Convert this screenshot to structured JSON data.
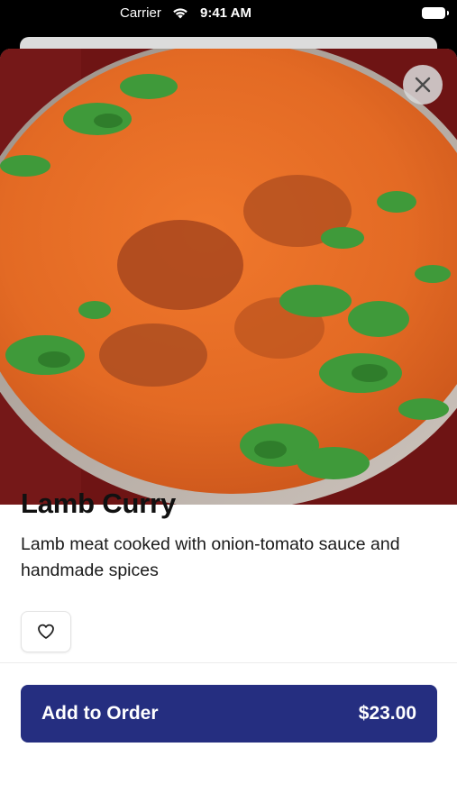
{
  "status_bar": {
    "carrier": "Carrier",
    "time": "9:41 AM",
    "wifi_icon": "wifi-icon",
    "battery_icon": "battery-icon"
  },
  "item": {
    "image_alt": "lamb-curry-photo",
    "name": "Lamb Curry",
    "description": "Lamb meat cooked with onion-tomato sauce and handmade spices"
  },
  "actions": {
    "close_icon": "close-icon",
    "favorite_icon": "heart-icon",
    "add_to_order_label": "Add to Order",
    "price": "$23.00"
  },
  "colors": {
    "primary_button": "#252e80",
    "curry": "#e36a24"
  }
}
